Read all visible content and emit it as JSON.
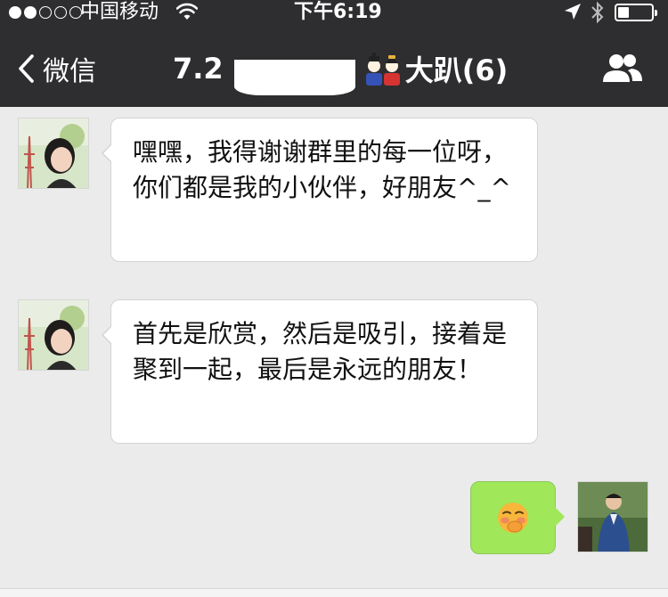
{
  "status": {
    "carrier": "中国移动",
    "time": "下午6:19",
    "signal_dots_on": 2,
    "signal_dots_total": 5
  },
  "nav": {
    "back_label": "微信",
    "title_prefix": "7.2",
    "title_suffix": "大趴(6)"
  },
  "messages": [
    {
      "side": "left",
      "text": "嘿嘿，我得谢谢群里的每一位呀，你们都是我的小伙伴，好朋友^_^"
    },
    {
      "side": "left",
      "text": "首先是欣赏，然后是吸引，接着是聚到一起，最后是永远的朋友！"
    },
    {
      "side": "right",
      "text": "🤭"
    }
  ],
  "colors": {
    "topbar": "#2e2e30",
    "chat_bg": "#ebebeb",
    "bubble_self": "#a0e75a",
    "bubble_other": "#ffffff"
  }
}
